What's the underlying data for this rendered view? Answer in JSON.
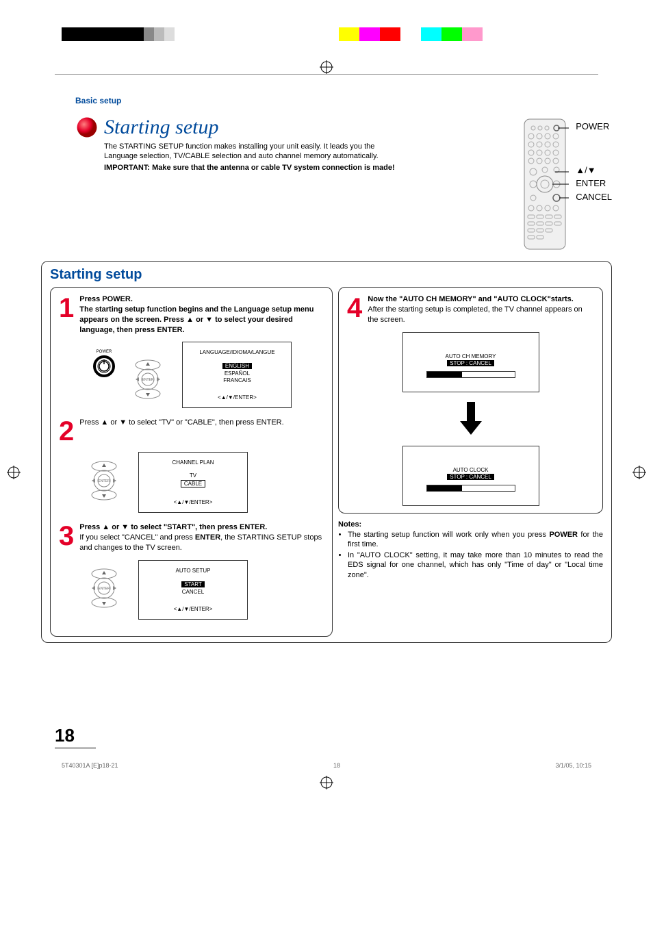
{
  "breadcrumb": "Basic setup",
  "page_title": "Starting setup",
  "intro": "The STARTING SETUP function makes installing your unit easily. It leads you the Language selection, TV/CABLE selection and auto channel memory automatically.",
  "intro_important": "IMPORTANT: Make sure that the antenna or cable TV system connection is made!",
  "remote_labels": {
    "power": "POWER",
    "updown": "▲/▼",
    "enter": "ENTER",
    "cancel": "CANCEL"
  },
  "section_heading": "Starting setup",
  "steps": {
    "1": {
      "num": "1",
      "lead": "Press POWER.",
      "body": "The starting setup function begins and the Language setup menu appears on the screen. Press ▲ or ▼ to select your desired language, then press ENTER.",
      "osd_title": "LANGUAGE/IDIOMA/LANGUE",
      "osd_items": [
        "ENGLISH",
        "ESPAÑOL",
        "FRANCAIS"
      ],
      "osd_footer": "<▲/▼/ENTER>",
      "power_label": "POWER",
      "enter_label": "ENTER"
    },
    "2": {
      "num": "2",
      "body_pre": "Press ▲ or ▼ to select \"TV\" or \"CABLE\", then press ENTER.",
      "osd_title": "CHANNEL PLAN",
      "osd_items": [
        "TV",
        "CABLE"
      ],
      "osd_footer": "<▲/▼/ENTER>",
      "enter_label": "ENTER"
    },
    "3": {
      "num": "3",
      "lead": "Press ▲ or ▼ to select \"START\", then press ENTER.",
      "body": "If you select \"CANCEL\" and press ENTER, the STARTING SETUP stops and changes to the TV screen.",
      "body_bold_word": "ENTER",
      "osd_title": "AUTO SETUP",
      "osd_items": [
        "START",
        "CANCEL"
      ],
      "osd_footer": "<▲/▼/ENTER>",
      "enter_label": "ENTER"
    },
    "4": {
      "num": "4",
      "lead": "Now the \"AUTO CH MEMORY\" and \"AUTO CLOCK\"starts.",
      "body": "After the starting setup is completed, the TV channel appears on the screen.",
      "osd1_title": "AUTO CH MEMORY",
      "osd1_sub": "STOP :  CANCEL",
      "osd2_title": "AUTO CLOCK",
      "osd2_sub": "STOP :  CANCEL"
    }
  },
  "notes": {
    "heading": "Notes:",
    "items": [
      "The starting setup function will work only when you press POWER for the first time.",
      "In \"AUTO CLOCK\" setting, it may take more than 10 minutes to read the EDS signal for one channel, which has only \"Time of day\" or \"Local time zone\"."
    ],
    "bold_word_0": "POWER"
  },
  "page_number": "18",
  "footer": {
    "doc": "5T40301A [E]p18-21",
    "pg": "18",
    "date": "3/1/05, 10:15"
  }
}
